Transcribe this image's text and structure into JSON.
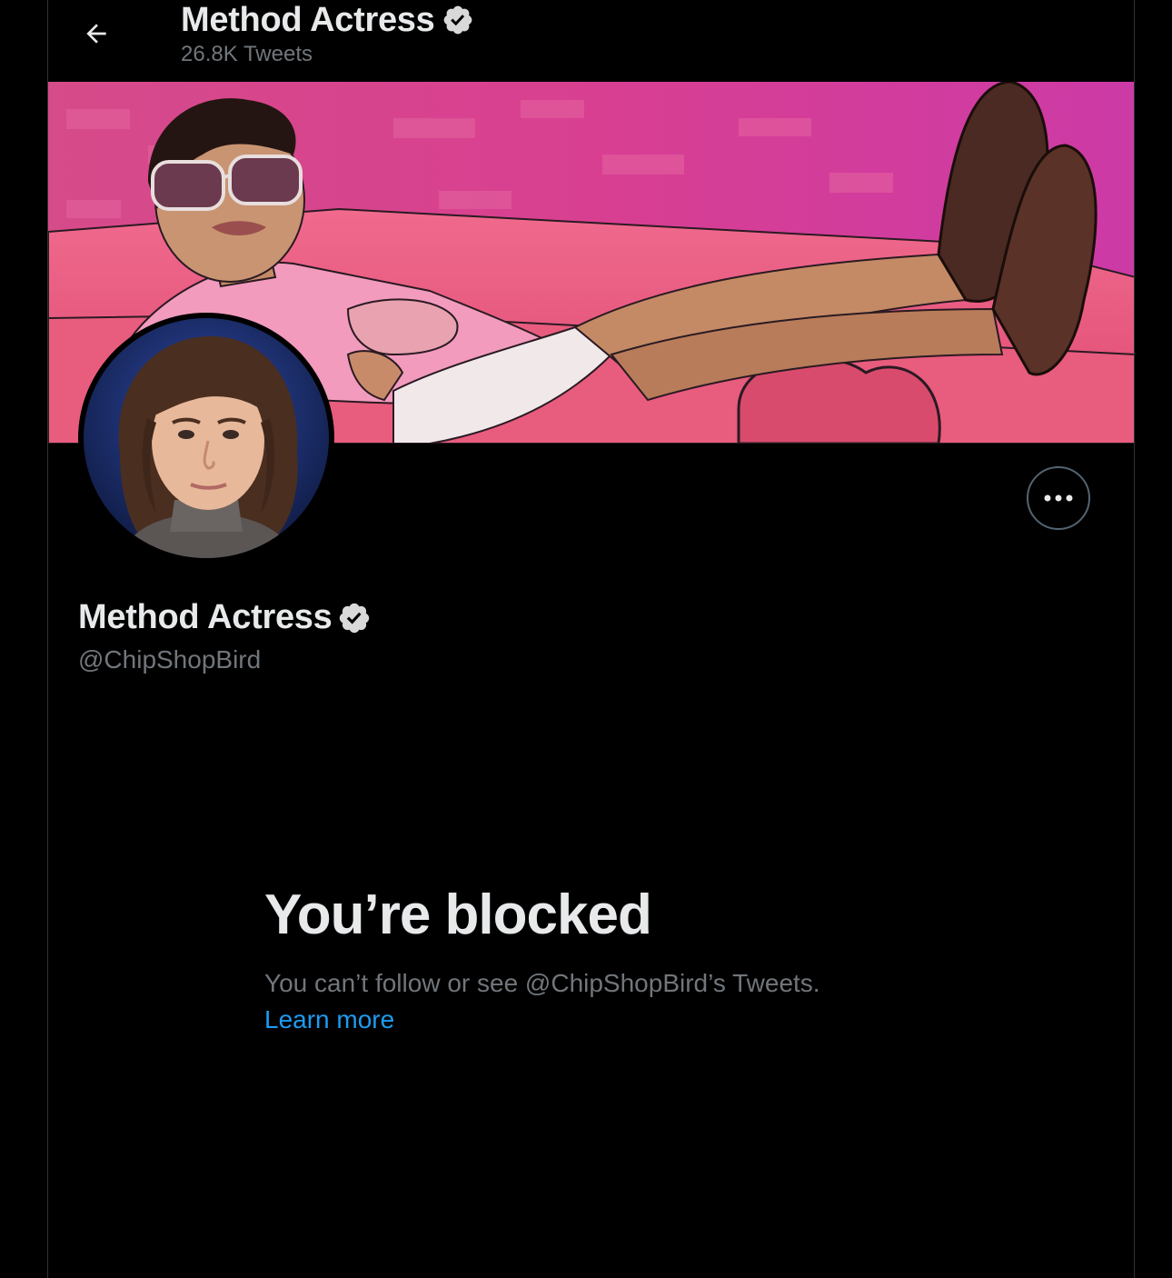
{
  "header": {
    "back_icon": "arrow-left-icon",
    "name": "Method Actress",
    "verified_icon": "verified-badge-icon",
    "tweet_count": "26.8K Tweets"
  },
  "banner": {
    "description_icon": "banner-image"
  },
  "profile": {
    "name": "Method Actress",
    "handle": "@ChipShopBird",
    "more_icon": "more-horizontal-icon"
  },
  "blocked": {
    "title": "You’re blocked",
    "description": "You can’t follow or see @ChipShopBird’s Tweets.",
    "learn_more": "Learn more"
  },
  "colors": {
    "background": "#000000",
    "text_primary": "#e7e9ea",
    "text_secondary": "#71767b",
    "link": "#1d9bf0",
    "border": "#2f3336"
  }
}
